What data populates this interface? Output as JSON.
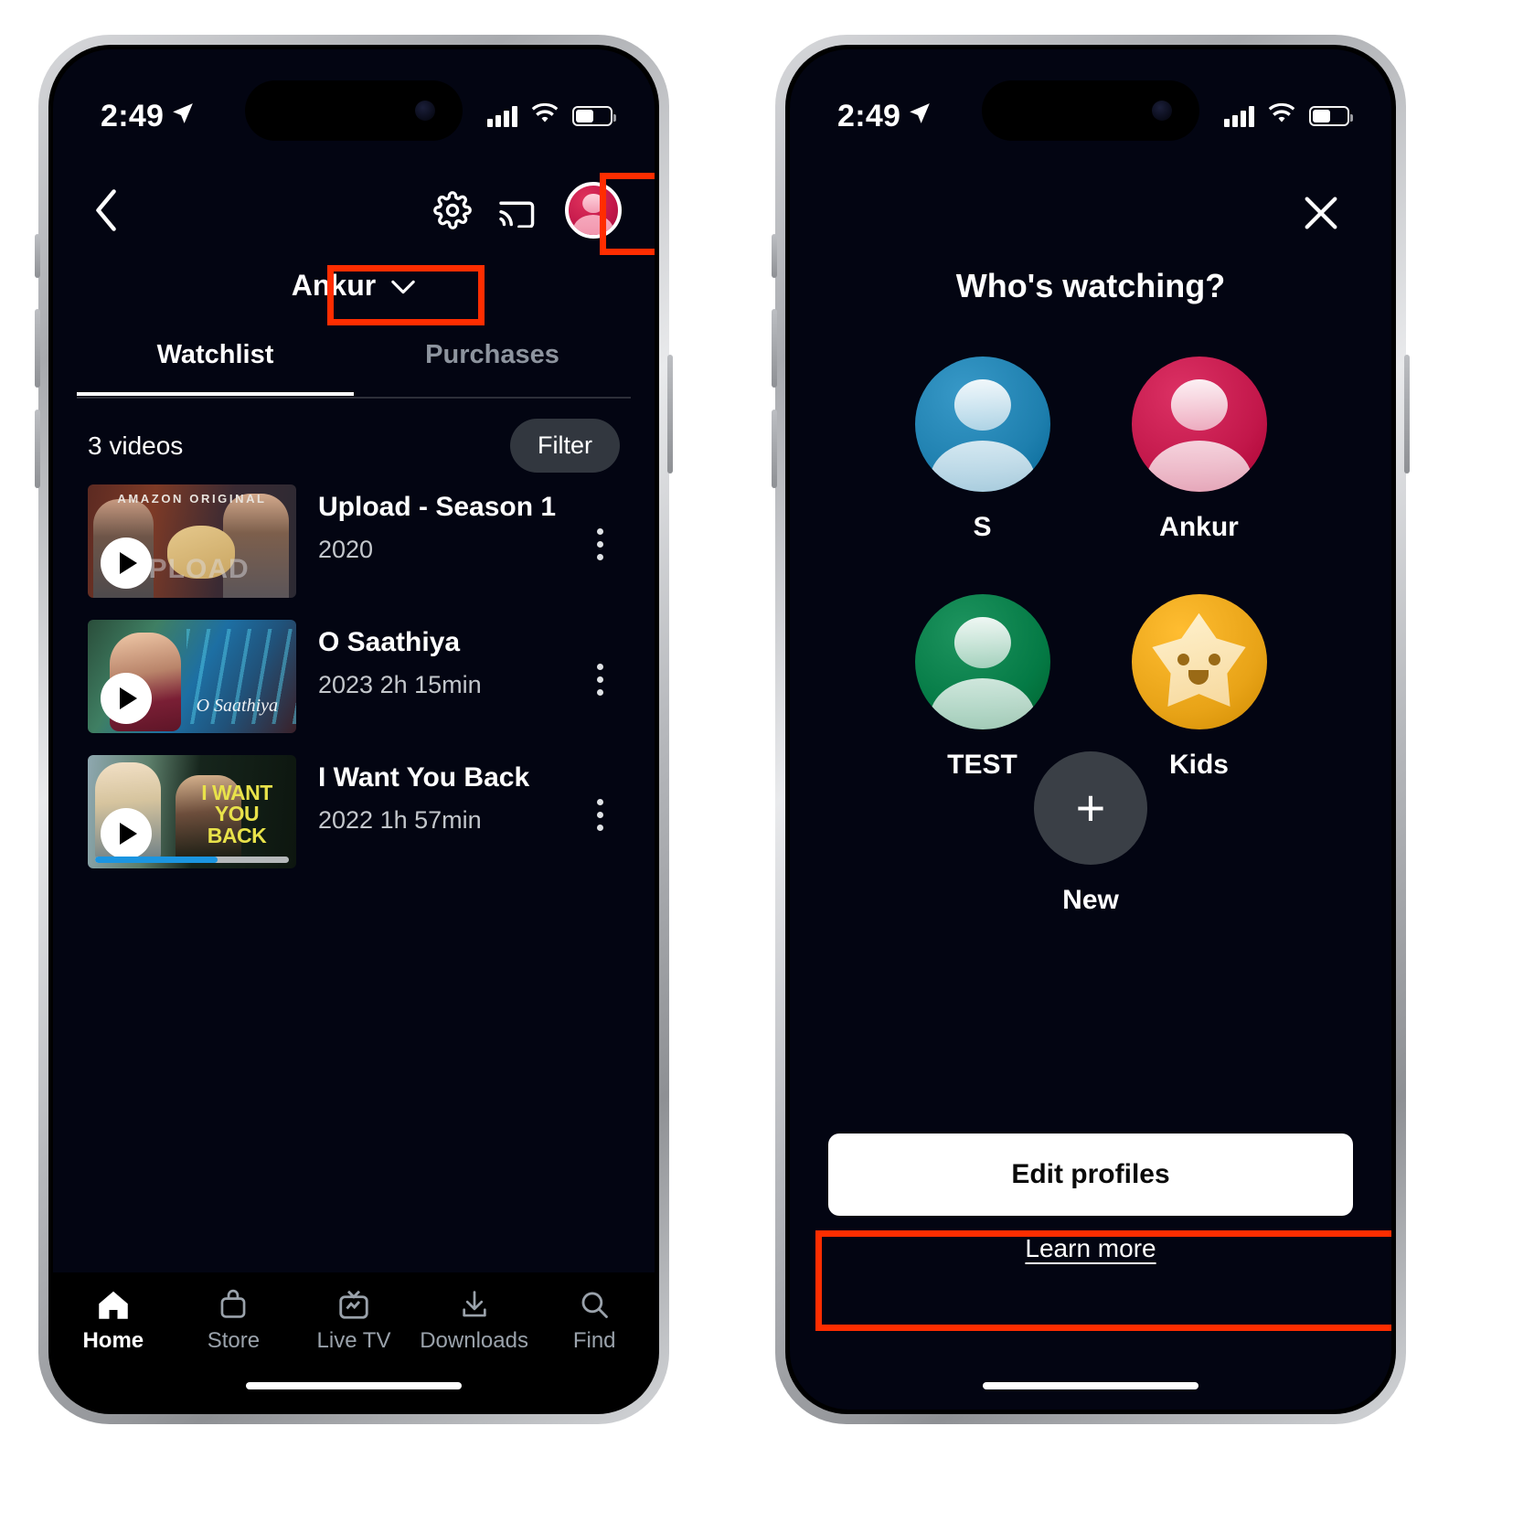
{
  "status_bar": {
    "time": "2:49",
    "location_icon": "location-arrow-icon",
    "signal_icon": "cellular-bars-icon",
    "wifi_icon": "wifi-icon",
    "battery_icon": "battery-icon"
  },
  "left_phone": {
    "topbar": {
      "back_icon": "chevron-left-icon",
      "settings_icon": "gear-icon",
      "cast_icon": "cast-icon",
      "avatar_icon": "profile-avatar-icon",
      "avatar_color": "#c2174a"
    },
    "profile_selector": {
      "name": "Ankur",
      "chevron_icon": "chevron-down-icon"
    },
    "tabs": [
      {
        "label": "Watchlist",
        "active": true
      },
      {
        "label": "Purchases",
        "active": false
      }
    ],
    "list_header": {
      "count_label": "3 videos",
      "filter_label": "Filter"
    },
    "videos": [
      {
        "title": "Upload - Season 1",
        "subtitle": "2020",
        "badge": "AMAZON ORIGINAL",
        "wordmark": "UPLOAD",
        "play_icon": "play-icon",
        "menu_icon": "kebab-menu-icon",
        "progress_percent": 0
      },
      {
        "title": "O Saathiya",
        "subtitle": "2023 2h 15min",
        "script_text": "O Saathiya",
        "play_icon": "play-icon",
        "menu_icon": "kebab-menu-icon",
        "progress_percent": 0
      },
      {
        "title": "I Want You Back",
        "subtitle": "2022 1h 57min",
        "poster_line1": "I WANT",
        "poster_line2": "YOU BACK",
        "play_icon": "play-icon",
        "menu_icon": "kebab-menu-icon",
        "progress_percent": 63
      }
    ],
    "tabbar": [
      {
        "label": "Home",
        "icon": "home-icon",
        "active": true
      },
      {
        "label": "Store",
        "icon": "shopping-bag-icon",
        "active": false
      },
      {
        "label": "Live TV",
        "icon": "live-tv-icon",
        "active": false
      },
      {
        "label": "Downloads",
        "icon": "download-icon",
        "active": false
      },
      {
        "label": "Find",
        "icon": "search-icon",
        "active": false
      }
    ]
  },
  "right_phone": {
    "close_icon": "close-x-icon",
    "title": "Who's watching?",
    "profiles": [
      {
        "name": "S",
        "color": "#1e7fae",
        "type": "person"
      },
      {
        "name": "Ankur",
        "color": "#c2174a",
        "type": "person"
      },
      {
        "name": "TEST",
        "color": "#047a45",
        "type": "person"
      },
      {
        "name": "Kids",
        "color": "#e8a317",
        "type": "kids-star"
      }
    ],
    "new_profile": {
      "label": "New",
      "icon": "plus-icon"
    },
    "edit_profiles_label": "Edit profiles",
    "learn_more_label": "Learn more"
  },
  "annotations": {
    "highlight_color": "#ff2d00",
    "boxes": [
      {
        "name": "avatar-highlight"
      },
      {
        "name": "profile-name-highlight"
      },
      {
        "name": "edit-profiles-highlight"
      }
    ]
  }
}
